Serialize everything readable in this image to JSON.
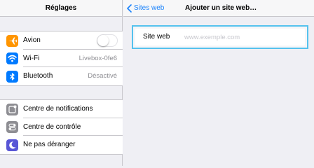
{
  "sidebar": {
    "title": "Réglages",
    "group1": [
      {
        "label": "Avion",
        "icon": "airplane-icon",
        "color": "#ff9500",
        "toggle": false
      },
      {
        "label": "Wi-Fi",
        "icon": "wifi-icon",
        "color": "#007aff",
        "value": "Livebox-0fe6"
      },
      {
        "label": "Bluetooth",
        "icon": "bluetooth-icon",
        "color": "#007aff",
        "value": "Désactivé"
      }
    ],
    "group2": [
      {
        "label": "Centre de notifications",
        "icon": "notifications-icon",
        "color": "#8e8e93"
      },
      {
        "label": "Centre de contrôle",
        "icon": "control-center-icon",
        "color": "#8e8e93"
      },
      {
        "label": "Ne pas déranger",
        "icon": "moon-icon",
        "color": "#5856d6"
      }
    ]
  },
  "detail": {
    "back_label": "Sites web",
    "title": "Ajouter un site web…",
    "field_label": "Site web",
    "field_value": "",
    "field_placeholder": "www.exemple.com"
  },
  "colors": {
    "accent": "#1a82fb",
    "focus_border": "#55c2ee"
  }
}
